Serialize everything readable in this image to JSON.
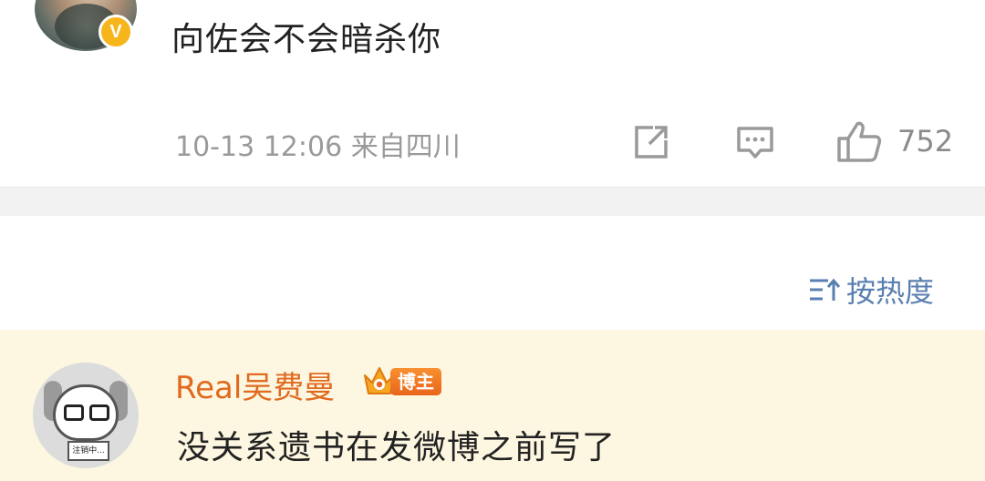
{
  "post": {
    "text": "向佐会不会暗杀你",
    "time": "10-13 12:06",
    "location": "来自四川",
    "verified_badge": "V",
    "actions": {
      "share_icon": "share-icon",
      "comment_icon": "comment-icon",
      "like_icon": "thumbs-up-icon",
      "like_count": "752"
    }
  },
  "sort": {
    "icon": "sort-icon",
    "label": "按热度"
  },
  "comment": {
    "username": "Real吴费曼",
    "badge": "博主",
    "avatar_sign": "注销中...",
    "text": "没关系遗书在发微博之前写了"
  },
  "colors": {
    "username": "#e06a20",
    "sort_accent": "#5a7fb0",
    "comment_bg": "#fdf6e0",
    "badge": "#e8651b",
    "verified": "#f7b51c"
  }
}
